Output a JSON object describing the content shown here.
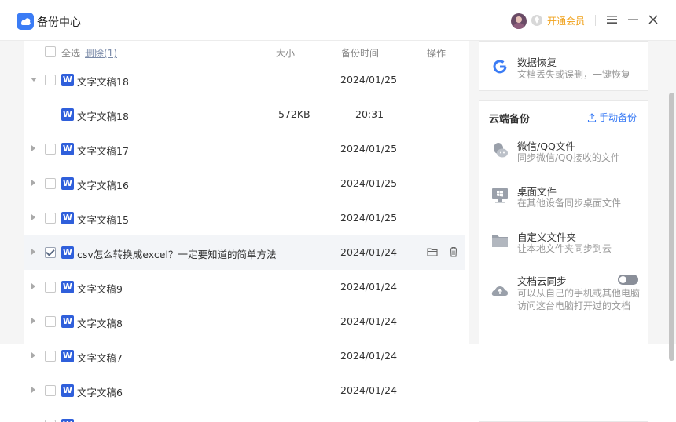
{
  "app": {
    "title": "备份中心",
    "vip_label": "开通会员"
  },
  "list": {
    "header": {
      "select_all": "全选",
      "delete": "删除(1)",
      "size": "大小",
      "time": "备份时间",
      "action": "操作"
    },
    "rows": [
      {
        "name": "文字文稿18",
        "date": "2024/01/25",
        "expanded": true,
        "checked": false
      },
      {
        "name": "文字文稿18",
        "size": "572KB",
        "time": "20:31",
        "child": true
      },
      {
        "name": "文字文稿17",
        "date": "2024/01/25",
        "checked": false
      },
      {
        "name": "文字文稿16",
        "date": "2024/01/25",
        "checked": false
      },
      {
        "name": "文字文稿15",
        "date": "2024/01/25",
        "checked": false
      },
      {
        "name": "csv怎么转换成excel？一定要知道的简单方法",
        "date": "2024/01/24",
        "checked": true,
        "selected": true
      },
      {
        "name": "文字文稿9",
        "date": "2024/01/24",
        "checked": false
      },
      {
        "name": "文字文稿8",
        "date": "2024/01/24",
        "checked": false
      },
      {
        "name": "文字文稿7",
        "date": "2024/01/24",
        "checked": false
      },
      {
        "name": "文字文稿6",
        "date": "2024/01/24",
        "checked": false
      }
    ]
  },
  "right": {
    "restore": {
      "title": "数据恢复",
      "sub": "文档丢失或误删，一键恢复"
    },
    "cloud": {
      "title": "云端备份",
      "manual": "手动备份",
      "items": [
        {
          "title": "微信/QQ文件",
          "sub": "同步微信/QQ接收的文件",
          "icon": "wechat-qq-icon"
        },
        {
          "title": "桌面文件",
          "sub": "在其他设备同步桌面文件",
          "icon": "desktop-icon"
        },
        {
          "title": "自定义文件夹",
          "sub": "让本地文件夹同步到云",
          "icon": "folder-icon"
        },
        {
          "title": "文档云同步",
          "sub": "可以从自己的手机或其他电脑访问这台电脑打开过的文档",
          "sub1": "可以从自己的手机或其他电脑",
          "sub2": "访问这台电脑打开过的文档",
          "icon": "cloud-upload-icon",
          "toggle": false
        }
      ]
    }
  },
  "colors": {
    "accent": "#3b7cf5",
    "vip": "#f0a11a",
    "word": "#2f5fdb"
  }
}
